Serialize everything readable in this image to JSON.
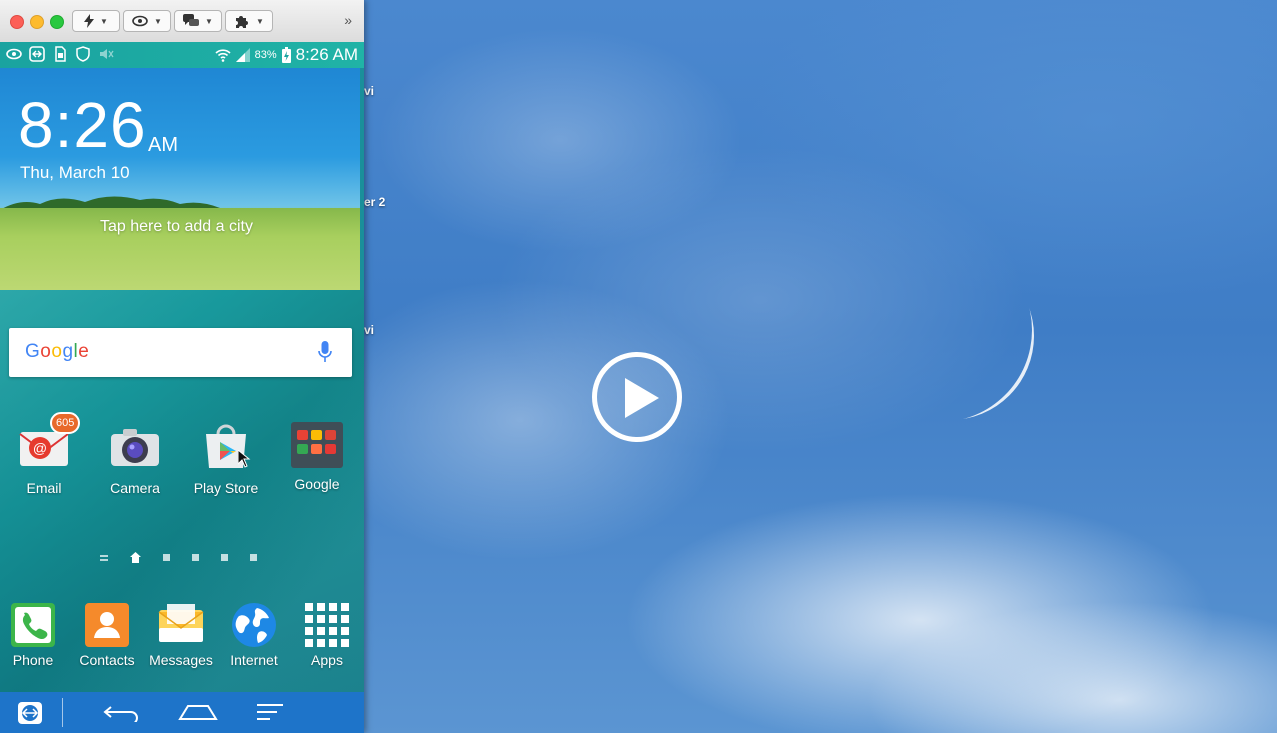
{
  "desktop": {
    "partial_labels": [
      "vi",
      "er 2",
      "vi"
    ]
  },
  "window": {
    "toolbar": {
      "buttons": [
        {
          "name": "lightning-menu",
          "icon": "lightning-icon"
        },
        {
          "name": "view-menu",
          "icon": "eye-icon"
        },
        {
          "name": "chat-menu",
          "icon": "chat-icon"
        },
        {
          "name": "tools-menu",
          "icon": "puzzle-icon"
        }
      ],
      "more": "»"
    }
  },
  "phone": {
    "status": {
      "battery": "83%",
      "time": "8:26 AM"
    },
    "clock": {
      "time": "8:26",
      "ampm": "AM",
      "date": "Thu, March 10",
      "weather_prompt": "Tap here to add a city"
    },
    "search": {
      "logo": "Google"
    },
    "apps": [
      {
        "label": "Email",
        "badge": "605"
      },
      {
        "label": "Camera"
      },
      {
        "label": "Play Store"
      },
      {
        "label": "Google"
      }
    ],
    "dock": [
      {
        "label": "Phone"
      },
      {
        "label": "Contacts"
      },
      {
        "label": "Messages"
      },
      {
        "label": "Internet"
      },
      {
        "label": "Apps"
      }
    ]
  },
  "colors": {
    "status_bar": "#20b3a6",
    "nav_bar": "#1e74c9",
    "email_badge": "#e8692a"
  }
}
